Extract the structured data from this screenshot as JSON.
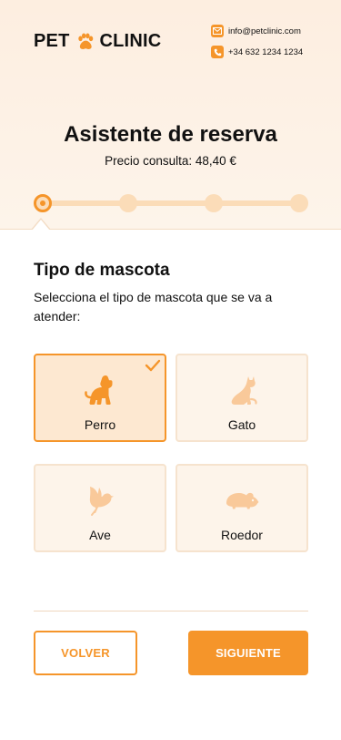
{
  "brand": {
    "name_left": "PET",
    "name_right": "CLINIC",
    "accent": "#f5952a"
  },
  "contact": {
    "email": "info@petclinic.com",
    "phone": "+34 632 1234 1234"
  },
  "header": {
    "title": "Asistente de reserva",
    "price": "Precio consulta: 48,40 €"
  },
  "steps": {
    "total": 4,
    "current": 1
  },
  "section": {
    "title": "Tipo de mascota",
    "description": "Selecciona el tipo de mascota que se va a atender:"
  },
  "options": [
    {
      "label": "Perro",
      "icon": "dog-icon",
      "selected": true
    },
    {
      "label": "Gato",
      "icon": "cat-icon",
      "selected": false
    },
    {
      "label": "Ave",
      "icon": "bird-icon",
      "selected": false
    },
    {
      "label": "Roedor",
      "icon": "rodent-icon",
      "selected": false
    }
  ],
  "actions": {
    "back_label": "VOLVER",
    "next_label": "SIGUIENTE"
  }
}
